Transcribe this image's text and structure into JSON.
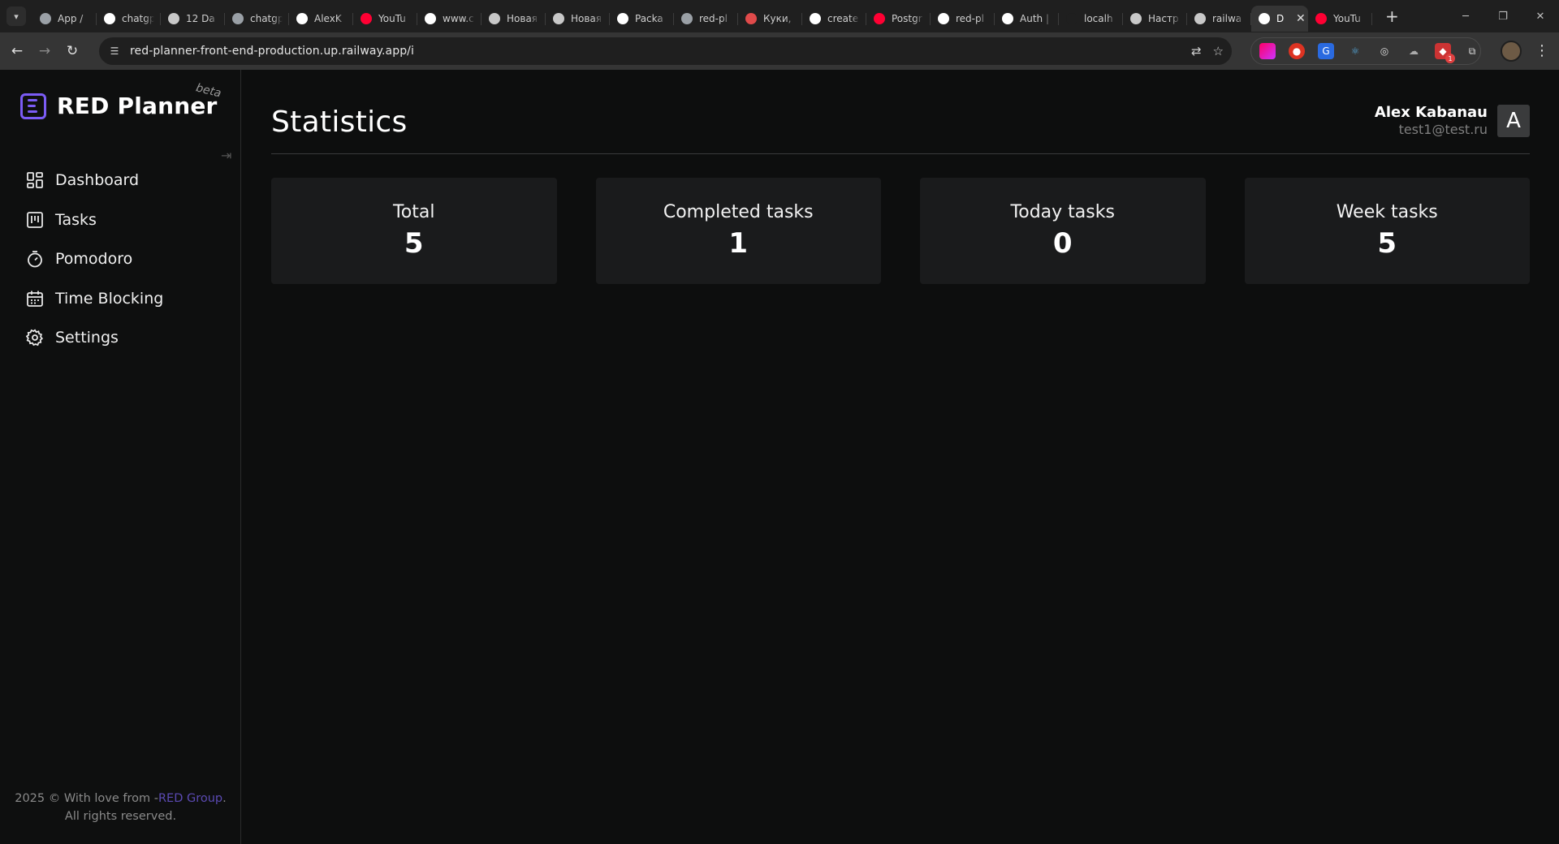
{
  "browser": {
    "tabs": [
      {
        "title": "App /",
        "favicon": "#9aa0a6",
        "icon": "globe-icon"
      },
      {
        "title": "chatgpt",
        "favicon": "#ffffff",
        "icon": "google-icon"
      },
      {
        "title": "12 Da",
        "favicon": "#c8c8c8",
        "icon": "openai-icon"
      },
      {
        "title": "chatgpt",
        "favicon": "#9aa0a6",
        "icon": "globe-icon"
      },
      {
        "title": "AlexK",
        "favicon": "#ffffff",
        "icon": "github-icon"
      },
      {
        "title": "YouTu",
        "favicon": "#ff0033",
        "icon": "youtube-icon"
      },
      {
        "title": "www.c",
        "favicon": "#ffffff",
        "icon": "google-icon"
      },
      {
        "title": "Новая",
        "favicon": "#c8c8c8",
        "icon": "chrome-icon"
      },
      {
        "title": "Новая",
        "favicon": "#c8c8c8",
        "icon": "chrome-icon"
      },
      {
        "title": "Packa",
        "favicon": "#ffffff",
        "icon": "github-icon"
      },
      {
        "title": "red-pl",
        "favicon": "#9aa0a6",
        "icon": "globe-icon"
      },
      {
        "title": "Куки,",
        "favicon": "#e04a4a",
        "icon": "cookie-icon"
      },
      {
        "title": "create",
        "favicon": "#ffffff",
        "icon": "google-icon"
      },
      {
        "title": "Postgr",
        "favicon": "#ff0033",
        "icon": "youtube-icon"
      },
      {
        "title": "red-pl",
        "favicon": "#ffffff",
        "icon": "triangle-icon"
      },
      {
        "title": "Auth |",
        "favicon": "#ffffff",
        "icon": "triangle-icon"
      },
      {
        "title": "localh",
        "favicon": "#1f1f1f",
        "icon": "triangle-icon"
      },
      {
        "title": "Настр",
        "favicon": "#c8c8c8",
        "icon": "gear-icon"
      },
      {
        "title": "railwa",
        "favicon": "#c8c8c8",
        "icon": "railway-icon"
      },
      {
        "title": "D",
        "favicon": "#ffffff",
        "icon": "triangle-icon",
        "active": true
      },
      {
        "title": "YouTu",
        "favicon": "#ff0033",
        "icon": "youtube-icon"
      }
    ],
    "url": "red-planner-front-end-production.up.railway.app/i"
  },
  "sidebar": {
    "logo_text": "RED Planner",
    "beta_label": "beta",
    "items": [
      {
        "label": "Dashboard",
        "icon": "dashboard-icon"
      },
      {
        "label": "Tasks",
        "icon": "tasks-icon"
      },
      {
        "label": "Pomodoro",
        "icon": "timer-icon"
      },
      {
        "label": "Time Blocking",
        "icon": "calendar-icon"
      },
      {
        "label": "Settings",
        "icon": "gear-icon"
      }
    ],
    "footer_prefix": "2025 © With love from -",
    "footer_link": "RED Group",
    "footer_suffix": ".",
    "footer_line2": "All rights reserved."
  },
  "header": {
    "title": "Statistics",
    "user_name": "Alex Kabanau",
    "user_email": "test1@test.ru",
    "avatar_letter": "A"
  },
  "stats": [
    {
      "label": "Total",
      "value": "5"
    },
    {
      "label": "Completed tasks",
      "value": "1"
    },
    {
      "label": "Today tasks",
      "value": "0"
    },
    {
      "label": "Week tasks",
      "value": "5"
    }
  ],
  "colors": {
    "accent": "#7b5cf5",
    "background": "#0d0e0e",
    "card": "#1a1b1c"
  }
}
